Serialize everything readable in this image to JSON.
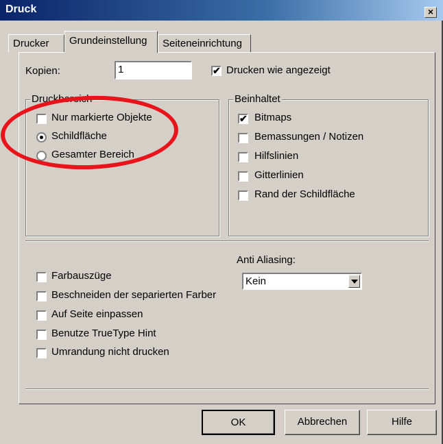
{
  "window": {
    "title": "Druck",
    "close_glyph": "×"
  },
  "tabs": [
    {
      "label": "Drucker",
      "active": false
    },
    {
      "label": "Grundeinstellung",
      "active": true
    },
    {
      "label": "Seiteneinrichtung",
      "active": false
    }
  ],
  "copies": {
    "label": "Kopien:",
    "value": "1"
  },
  "print_as_shown": {
    "label": "Drucken wie angezeigt",
    "checked": true
  },
  "print_area": {
    "title": "Druckbereich",
    "options": [
      {
        "label": "Nur markierte Objekte",
        "checked": false
      },
      {
        "label": "Schildfläche",
        "selected": true
      },
      {
        "label": "Gesamter Bereich",
        "selected": false
      }
    ]
  },
  "includes": {
    "title": "Beinhaltet",
    "items": [
      {
        "label": "Bitmaps",
        "checked": true
      },
      {
        "label": "Bemassungen / Notizen",
        "checked": false
      },
      {
        "label": "Hilfslinien",
        "checked": false
      },
      {
        "label": "Gitterlinien",
        "checked": false
      },
      {
        "label": "Rand der Schildfläche",
        "checked": false
      }
    ]
  },
  "options": [
    {
      "label": "Farbauszüge",
      "checked": false
    },
    {
      "label": "Beschneiden der separierten Farber",
      "checked": false
    },
    {
      "label": "Auf Seite einpassen",
      "checked": false
    },
    {
      "label": "Benutze TrueType Hint",
      "checked": false
    },
    {
      "label": "Umrandung nicht drucken",
      "checked": false
    }
  ],
  "anti_aliasing": {
    "label": "Anti Aliasing:",
    "value": "Kein"
  },
  "buttons": {
    "ok": "OK",
    "cancel": "Abbrechen",
    "help": "Hilfe"
  },
  "check_glyph": "✔",
  "colors": {
    "title_bar": "#0a246a",
    "dialog_bg": "#d4d0c8",
    "annotation": "#e8141c"
  }
}
